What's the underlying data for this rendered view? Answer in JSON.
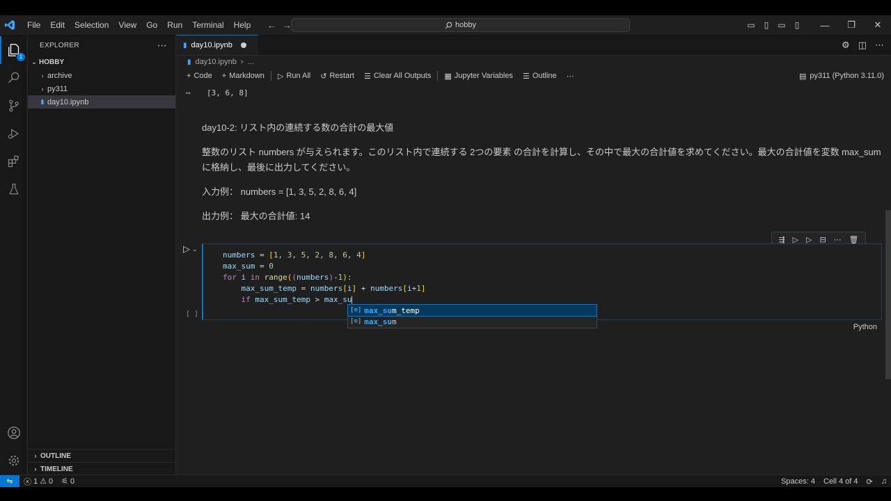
{
  "menu": [
    "File",
    "Edit",
    "Selection",
    "View",
    "Go",
    "Run",
    "Terminal",
    "Help"
  ],
  "search": {
    "text": "hobby"
  },
  "activity_badge": "1",
  "explorer": {
    "header": "EXPLORER",
    "root": "HOBBY",
    "items": [
      {
        "label": "archive",
        "type": "folder"
      },
      {
        "label": "py311",
        "type": "folder"
      },
      {
        "label": "day10.ipynb",
        "type": "file"
      }
    ],
    "outline": "OUTLINE",
    "timeline": "TIMELINE"
  },
  "tab": {
    "label": "day10.ipynb"
  },
  "breadcrumb": {
    "file": "day10.ipynb",
    "more": "..."
  },
  "toolbar": {
    "code": "Code",
    "markdown": "Markdown",
    "run_all": "Run All",
    "restart": "Restart",
    "clear": "Clear All Outputs",
    "variables": "Jupyter Variables",
    "outline": "Outline",
    "more": "⋯",
    "kernel": "py311 (Python 3.11.0)"
  },
  "output": {
    "ellipsis": "⋯",
    "text": "[3, 6, 8]"
  },
  "markdown": {
    "title": "day10-2: リスト内の連続する数の合計の最大値",
    "para": "整数のリスト numbers が与えられます。このリスト内で連続する 2つの要素 の合計を計算し、その中で最大の合計値を求めてください。最大の合計値を変数 max_sum に格納し、最後に出力してください。",
    "input_example": "入力例： numbers = [1, 3, 5, 2, 8, 6, 4]",
    "output_example": "出力例： 最大の合計値: 14"
  },
  "cell": {
    "language": "Python",
    "exec_count": "[ ]"
  },
  "suggest": [
    {
      "match": "max_su",
      "rest": "m_temp",
      "active": true
    },
    {
      "match": "max_su",
      "rest": "m",
      "active": false
    }
  ],
  "status": {
    "errors": "1",
    "warnings": "0",
    "ports": "0",
    "spaces": "Spaces: 4",
    "cell": "Cell 4 of 4"
  },
  "colors": {
    "accent": "#0078d4",
    "background": "#1f1f1f",
    "sidebar": "#181818"
  }
}
